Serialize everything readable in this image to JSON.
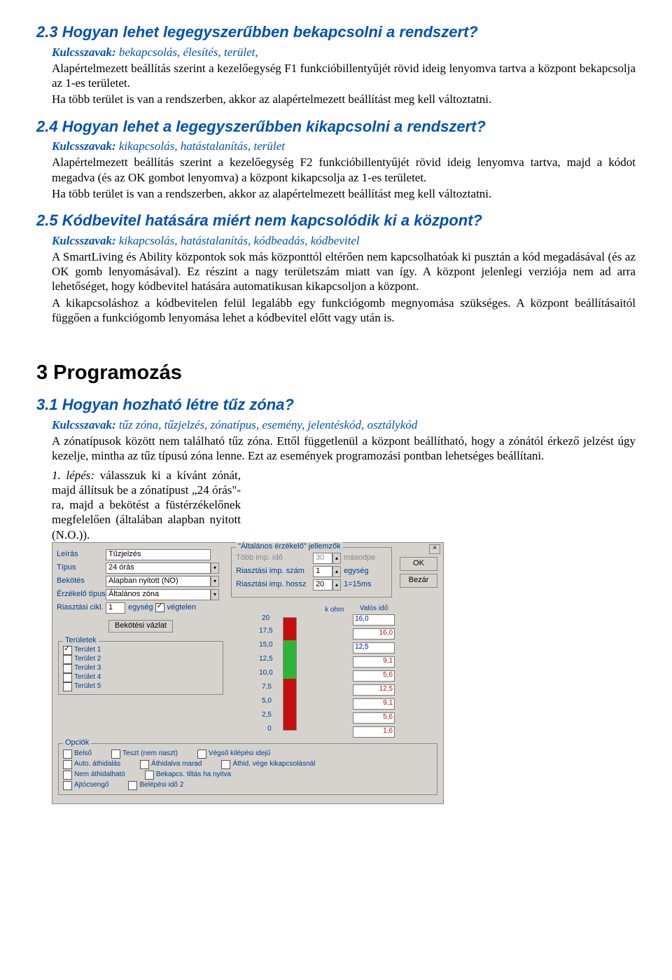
{
  "s23": {
    "title": "2.3 Hogyan lehet legegyszerűbben bekapcsolni a rendszert?",
    "kw_label": "Kulcsszavak:",
    "kw": " bekapcsolás, élesítés, terület,",
    "p1": "Alapértelmezett beállítás szerint a kezelőegység F1 funkcióbillentyűjét rövid ideig lenyomva tartva a központ bekapcsolja az 1-es területet.",
    "p2": "Ha több terület is van a rendszerben, akkor az alapértelmezett beállítást meg kell változtatni."
  },
  "s24": {
    "title": "2.4 Hogyan lehet a legegyszerűbben kikapcsolni a rendszert?",
    "kw_label": "Kulcsszavak:",
    "kw": " kikapcsolás, hatástalanítás, terület",
    "p1": "Alapértelmezett beállítás szerint a kezelőegység F2 funkcióbillentyűjét rövid ideig lenyomva tartva, majd a kódot megadva (és az OK gombot lenyomva) a központ kikapcsolja az 1-es területet.",
    "p2": "Ha több terület is van a rendszerben, akkor az alapértelmezett beállítást meg kell változtatni."
  },
  "s25": {
    "title": "2.5 Kódbevitel hatására miért nem kapcsolódik ki a központ?",
    "kw_label": "Kulcsszavak:",
    "kw": " kikapcsolás, hatástalanítás, kódbeadás, kódbevitel",
    "p1": "A SmartLiving és Ability központok sok más központtól eltérően nem kapcsolhatóak ki pusztán a kód megadásával (és az OK gomb lenyomásával). Ez részint a nagy területszám miatt van így. A központ jelenlegi verziója nem ad arra lehetőséget, hogy kódbevitel hatására automatikusan kikapcsoljon a központ.",
    "p2": "A kikapcsoláshoz a kódbevitelen felül legalább egy funkciógomb megnyomása szükséges. A központ beállításaitól függően a funkciógomb lenyomása lehet a kódbevitel előtt vagy után is."
  },
  "s3": {
    "title": "3 Programozás"
  },
  "s31": {
    "title": "3.1 Hogyan hozható létre tűz zóna?",
    "kw_label": "Kulcsszavak:",
    "kw": " tűz zóna, tűzjelzés, zónatípus, esemény, jelentéskód, osztálykód",
    "p1": "A zónatípusok között nem található tűz zóna. Ettől függetlenül a központ beállítható, hogy a zónától érkező jelzést úgy kezelje, mintha az tűz típusú zóna lenne. Ezt az események programozási pontban lehetséges beállítani.",
    "step_label": "1. lépés:",
    "step_text": " válasszuk ki a kívánt zónát, majd állítsuk be a zónatípust „24 órás\"-ra, majd a bekötést a füstérzékelőnek megfelelően (általában alapban nyitott (N.O.))."
  },
  "dialog": {
    "labels": {
      "leiras": "Leírás",
      "tipus": "Típus",
      "bekotes": "Bekötés",
      "erzekelo": "Érzékelő típus",
      "riasztasi_cikl": "Riasztási cikl.",
      "egyseg": "egység",
      "vegtelen": "végtelen"
    },
    "values": {
      "leiras": "Tűzjelzés",
      "tipus": "24 órás",
      "bekotes": "Alapban nyitott (NO)",
      "erzekelo": "Általános zóna",
      "riasztasi_cikl": "1"
    },
    "sensor_group": {
      "title": "\"Általános érzékelő\" jellemzők",
      "tobb_imp_ido": "Több imp. idő",
      "tobb_imp_val": "30",
      "masodperc": "másodpe",
      "riasztasi_imp_szam": "Riasztási imp. szám",
      "riasztasi_imp_szam_val": "1",
      "egyseg": "egység",
      "riasztasi_imp_hossz": "Riasztási imp. hossz",
      "riasztasi_imp_hossz_val": "20",
      "time_unit": "1=15ms"
    },
    "buttons": {
      "ok": "OK",
      "bezar": "Bezár"
    },
    "bekotesi_vazlat": "Bekötési vázlat",
    "teruletek": {
      "title": "Területek",
      "items": [
        "Terület 1",
        "Terület 2",
        "Terület 3",
        "Terület 4",
        "Terület 5"
      ]
    },
    "opciok": {
      "title": "Opciók",
      "row1": [
        "Belső",
        "Teszt (nem riaszt)",
        "Végső kilépési idejű"
      ],
      "row2": [
        "Auto. áthidalás",
        "Áthidalva marad",
        "Áthid. vége kikapcsolásnál"
      ],
      "row3": [
        "Nem áthidalható",
        "Bekapcs. tiltás ha nyitva",
        ""
      ],
      "row4": [
        "Ajtócsengő",
        "Belépési idő 2",
        ""
      ]
    },
    "chart": {
      "kohm": "k ohm",
      "valos": "Valós idő",
      "ticks": [
        "20",
        "17,5",
        "15,0",
        "12,5",
        "10,0",
        "7,5",
        "5,0",
        "2,5",
        "0"
      ],
      "vbox": [
        {
          "l": "16,0",
          "r": ""
        },
        {
          "l": "",
          "r": "16,0"
        },
        {
          "l": "12,5",
          "r": ""
        },
        {
          "l": "",
          "r": "9,1"
        },
        {
          "l": "",
          "r": "5,6"
        },
        {
          "l": "",
          "r": "12,5"
        },
        {
          "l": "",
          "r": "9,1"
        },
        {
          "l": "",
          "r": "5,6"
        },
        {
          "l": "",
          "r": "1,6"
        }
      ]
    }
  },
  "chart_data": {
    "type": "bar",
    "title": "Bekötési vázlat — ellenállás sávok",
    "ylabel": "k ohm",
    "ylim": [
      0,
      20
    ],
    "ticks": [
      0,
      2.5,
      5.0,
      7.5,
      10.0,
      12.5,
      15.0,
      17.5,
      20
    ],
    "bands": [
      {
        "from": 16.0,
        "to": 20.0,
        "color": "red"
      },
      {
        "from": 9.1,
        "to": 16.0,
        "color": "green"
      },
      {
        "from": 0.0,
        "to": 9.1,
        "color": "red"
      }
    ],
    "realtime_values": [
      16.0,
      16.0,
      12.5,
      9.1,
      5.6,
      12.5,
      9.1,
      5.6,
      1.6
    ]
  }
}
